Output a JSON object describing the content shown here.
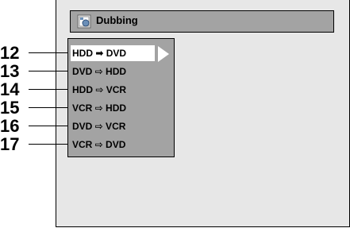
{
  "window": {
    "title": "Dubbing",
    "icon": "dubbing-icon"
  },
  "menu": {
    "items": [
      {
        "label": "HDD ➡ DVD",
        "callout": "12",
        "selected": true
      },
      {
        "label": "DVD ⇨ HDD",
        "callout": "13",
        "selected": false
      },
      {
        "label": "HDD ⇨ VCR",
        "callout": "14",
        "selected": false
      },
      {
        "label": "VCR ⇨ HDD",
        "callout": "15",
        "selected": false
      },
      {
        "label": "DVD ⇨ VCR",
        "callout": "16",
        "selected": false
      },
      {
        "label": "VCR ⇨ DVD",
        "callout": "17",
        "selected": false
      }
    ]
  },
  "colors": {
    "panel": "#a3a3a3",
    "background": "#e7e7e7",
    "highlight": "#ffffff"
  }
}
